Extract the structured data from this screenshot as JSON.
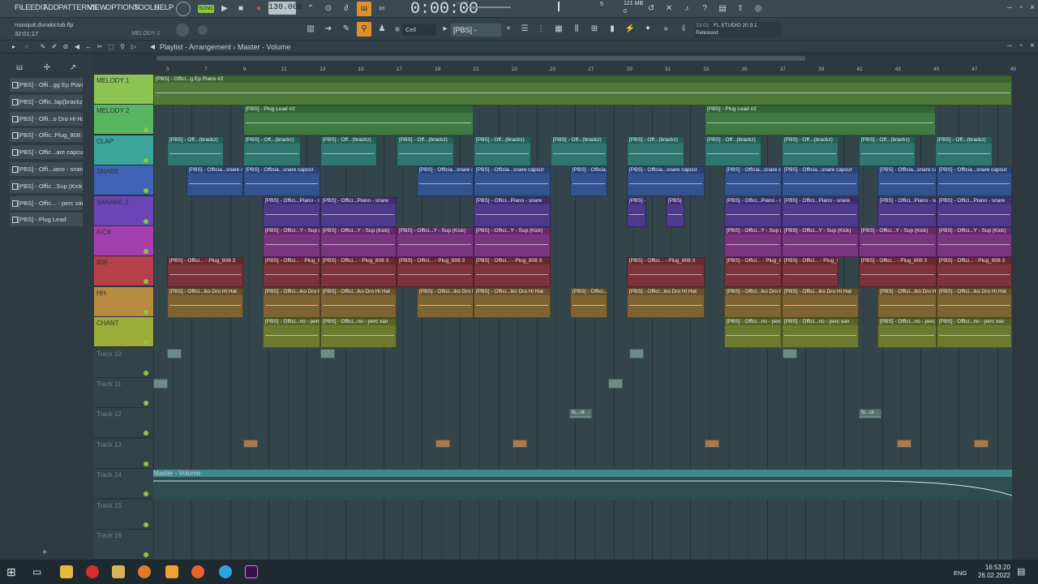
{
  "menu": [
    "FILE",
    "EDIT",
    "ADD",
    "PATTERNS",
    "VIEW",
    "OPTIONS",
    "TOOLS",
    "HELP"
  ],
  "transport": {
    "mode": "SONG",
    "tempo": "130.000",
    "time": "0:00:00",
    "time_small": "M:S:CS",
    "memory": "121 MB",
    "cpu_top": "5",
    "cpu_bottom": "0"
  },
  "project": {
    "filename": "mosquit.durakiclub.flp",
    "length": "32:01:17",
    "channel": "MELODY 2"
  },
  "toolbar": {
    "snap": "Cell",
    "pattern_selector": "[PBS] - ...snare"
  },
  "fl_info": {
    "date": "23.02",
    "version": "FL STUDIO 20.9.1",
    "status": "Released"
  },
  "playlist": {
    "breadcrumb": "Playlist - Arrangement › Master - Volume"
  },
  "patterns": [
    "[PBS] - Offi...gg Ep Piano",
    "[PBS] - Offic..lap(brackz)",
    "[PBS] - Offi...o Dro Hi Hat",
    "[PBS] - Offic..Plug_808 3",
    "[PBS] - Offic...are capcut",
    "[PBS] - Offi...iano - snare",
    "[PBS] - Offic...Sup (Kick)",
    "[PBS] - Offic... - perc xan",
    "[PBS] - Plug Lead"
  ],
  "ruler": [
    "5",
    "7",
    "9",
    "11",
    "13",
    "15",
    "17",
    "19",
    "21",
    "23",
    "25",
    "27",
    "29",
    "31",
    "33",
    "35",
    "37",
    "39",
    "41",
    "43",
    "45",
    "47",
    "49"
  ],
  "tracks": [
    {
      "name": "MELODY 1",
      "color": "#8dc451"
    },
    {
      "name": "MELODY 2",
      "color": "#58b661"
    },
    {
      "name": "CLAP",
      "color": "#3aa69a"
    },
    {
      "name": "SNARE",
      "color": "#3f63b5"
    },
    {
      "name": "SANARE 2",
      "color": "#6a46b6"
    },
    {
      "name": "KICK",
      "color": "#a53fb0"
    },
    {
      "name": "808",
      "color": "#b5404a"
    },
    {
      "name": "HH",
      "color": "#b68a3f"
    },
    {
      "name": "CHANT",
      "color": "#9bae39"
    },
    {
      "name": "Track 10",
      "color": ""
    },
    {
      "name": "Track 11",
      "color": ""
    },
    {
      "name": "Track 12",
      "color": ""
    },
    {
      "name": "Track 13",
      "color": ""
    },
    {
      "name": "Track 14",
      "color": ""
    },
    {
      "name": "Track 15",
      "color": ""
    },
    {
      "name": "Track 16",
      "color": ""
    }
  ],
  "clips": {
    "melody1": "[PBS] - Offici...g Ep Piano #2",
    "melody2": "[PBS] - Plug Lead #2",
    "clap": "[PBS] - Off...(brackz)",
    "snare": "[PBS] - Officia...snare capcut",
    "snare2": "[PBS] - Offici...Piano - snare",
    "kick": "[PBS] - Offici...Y - Sup (Kick)",
    "808": "[PBS] - Offici... - Plug_808 3",
    "hh": "[PBS] - Offici...iko Dro Hi Hat",
    "chant": "[PBS] - Offici...no - perc xan",
    "fx": "fx...ol",
    "automation": "Master - Volume"
  },
  "taskbar": {
    "lang": "ENG",
    "time": "16:53:20",
    "date": "26.02.2022"
  }
}
